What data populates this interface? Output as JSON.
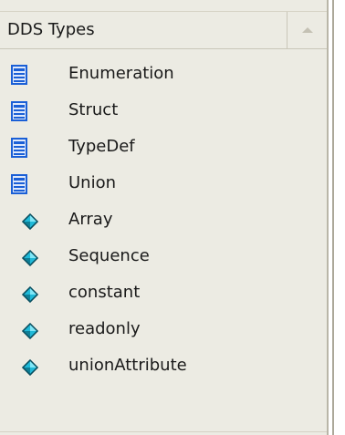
{
  "panel": {
    "title": "DDS Types",
    "collapse_icon": "chevron-up-icon"
  },
  "items": [
    {
      "label": "Enumeration",
      "icon": "class-stereotype-icon"
    },
    {
      "label": "Struct",
      "icon": "class-stereotype-icon"
    },
    {
      "label": "TypeDef",
      "icon": "class-stereotype-icon"
    },
    {
      "label": "Union",
      "icon": "class-stereotype-icon"
    },
    {
      "label": "Array",
      "icon": "attribute-gem-icon"
    },
    {
      "label": "Sequence",
      "icon": "attribute-gem-icon"
    },
    {
      "label": "constant",
      "icon": "attribute-gem-icon"
    },
    {
      "label": "readonly",
      "icon": "attribute-gem-icon"
    },
    {
      "label": "unionAttribute",
      "icon": "attribute-gem-icon"
    }
  ],
  "colors": {
    "panel_bg": "#ecebe3",
    "class_icon_blue": "#1a5fd6",
    "gem_cyan": "#1fb9d8"
  }
}
